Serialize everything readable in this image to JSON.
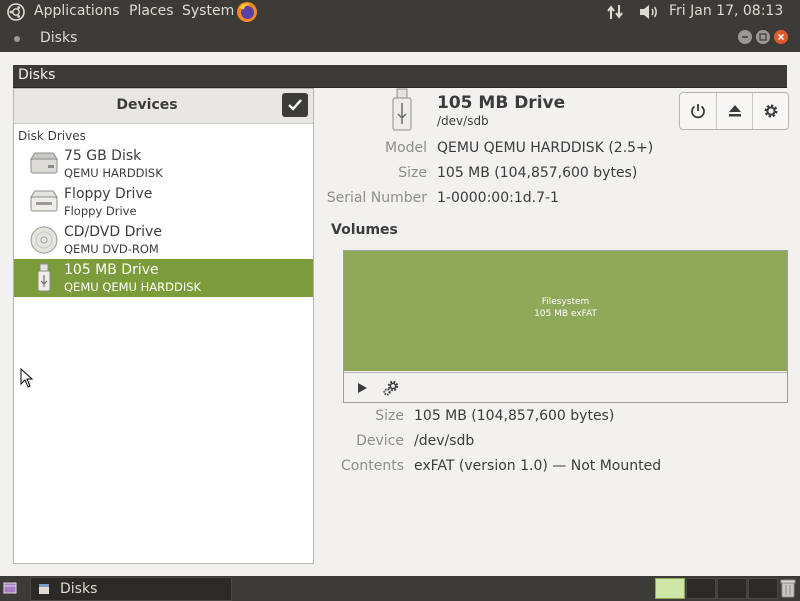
{
  "top_panel": {
    "menus": [
      "Applications",
      "Places",
      "System"
    ],
    "clock": "Fri Jan 17, 08:13"
  },
  "window": {
    "title": "Disks",
    "header_title": "Disks"
  },
  "sidebar": {
    "title": "Devices",
    "section_label": "Disk Drives",
    "drives": [
      {
        "name": "75 GB Disk",
        "sub": "QEMU HARDDISK",
        "icon": "harddisk-icon"
      },
      {
        "name": "Floppy Drive",
        "sub": "Floppy Drive",
        "icon": "floppy-icon"
      },
      {
        "name": "CD/DVD Drive",
        "sub": "QEMU DVD-ROM",
        "icon": "optical-disc-icon"
      },
      {
        "name": "105 MB Drive",
        "sub": "QEMU QEMU HARDDISK",
        "icon": "usb-drive-icon"
      }
    ],
    "selected_index": 3
  },
  "drive": {
    "title": "105 MB Drive",
    "path": "/dev/sdb",
    "props": [
      {
        "label": "Model",
        "value": "QEMU QEMU HARDDISK (2.5+)"
      },
      {
        "label": "Size",
        "value": "105 MB (104,857,600 bytes)"
      },
      {
        "label": "Serial Number",
        "value": "1-0000:00:1d.7-1"
      }
    ]
  },
  "volumes": {
    "label": "Volumes",
    "partition_fs": "Filesystem",
    "partition_size": "105 MB exFAT",
    "partition_color": "#8fa85a",
    "props": [
      {
        "label": "Size",
        "value": "105 MB (104,857,600 bytes)"
      },
      {
        "label": "Device",
        "value": "/dev/sdb"
      },
      {
        "label": "Contents",
        "value": "exFAT (version 1.0) — Not Mounted"
      }
    ]
  },
  "taskbar": {
    "task_label": "Disks"
  },
  "colors": {
    "accent": "#7c9c3c",
    "panel": "#3c3b37",
    "close": "#e05a2b"
  }
}
